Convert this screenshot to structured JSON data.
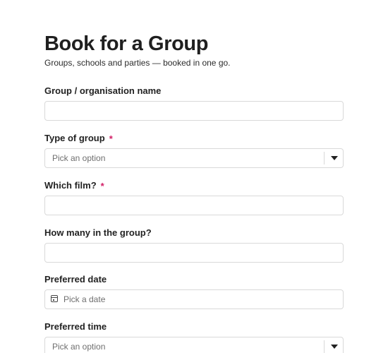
{
  "header": {
    "title": "Book for a Group",
    "subtitle": "Groups, schools and parties — booked in one go."
  },
  "fields": {
    "group_name": {
      "label": "Group / organisation name",
      "value": "",
      "required": false
    },
    "group_type": {
      "label": "Type of group",
      "required_mark": "*",
      "placeholder": "Pick an option",
      "icon": "chevron-down-icon"
    },
    "film": {
      "label": "Which film?",
      "required_mark": "*",
      "value": ""
    },
    "group_size": {
      "label": "How many in the group?",
      "value": ""
    },
    "preferred_date": {
      "label": "Preferred date",
      "placeholder": "Pick a date",
      "icon": "calendar-icon"
    },
    "preferred_time": {
      "label": "Preferred time",
      "placeholder": "Pick an option",
      "icon": "chevron-down-icon"
    }
  },
  "colors": {
    "required": "#d21f66",
    "border": "#d9d9d9",
    "text": "#1f1f1f",
    "placeholder": "#6f6f6f"
  }
}
